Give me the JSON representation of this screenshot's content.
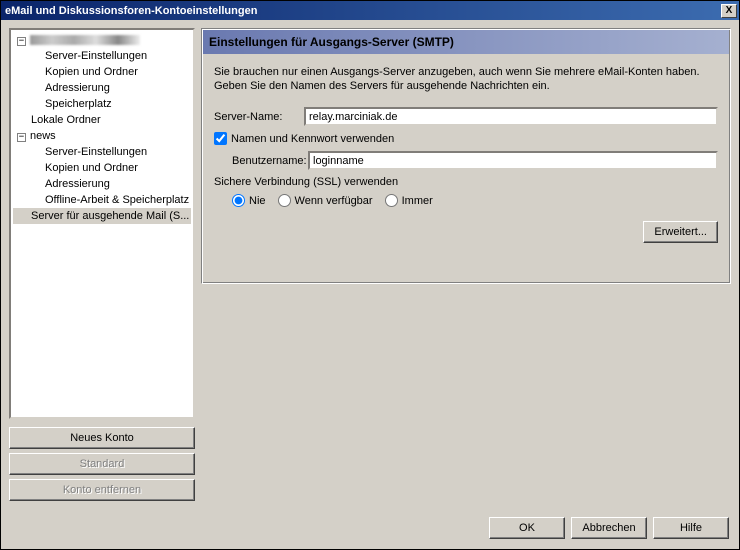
{
  "window": {
    "title": "eMail und Diskussionsforen-Kontoeinstellungen",
    "close": "X"
  },
  "tree": {
    "account1": {
      "server_settings": "Server-Einstellungen",
      "copies_folders": "Kopien und Ordner",
      "addressing": "Adressierung",
      "disk_space": "Speicherplatz"
    },
    "local_folders": "Lokale Ordner",
    "news": {
      "label": "news",
      "server_settings": "Server-Einstellungen",
      "copies_folders": "Kopien und Ordner",
      "addressing": "Adressierung",
      "offline": "Offline-Arbeit & Speicherplatz"
    },
    "outgoing": "Server für ausgehende Mail (S..."
  },
  "sidebar_buttons": {
    "new_account": "Neues Konto",
    "default": "Standard",
    "remove": "Konto entfernen"
  },
  "panel": {
    "heading": "Einstellungen für Ausgangs-Server (SMTP)",
    "description": "Sie brauchen nur einen Ausgangs-Server anzugeben, auch wenn Sie mehrere eMail-Konten haben. Geben Sie den Namen des Servers für ausgehende Nachrichten ein.",
    "server_name_label": "Server-Name:",
    "server_name_value": "relay.marciniak.de",
    "use_auth_label": "Namen und Kennwort verwenden",
    "username_label": "Benutzername:",
    "username_value": "loginname",
    "ssl_label": "Sichere Verbindung (SSL) verwenden",
    "ssl_never": "Nie",
    "ssl_when_avail": "Wenn verfügbar",
    "ssl_always": "Immer",
    "advanced": "Erweitert..."
  },
  "footer": {
    "ok": "OK",
    "cancel": "Abbrechen",
    "help": "Hilfe"
  }
}
